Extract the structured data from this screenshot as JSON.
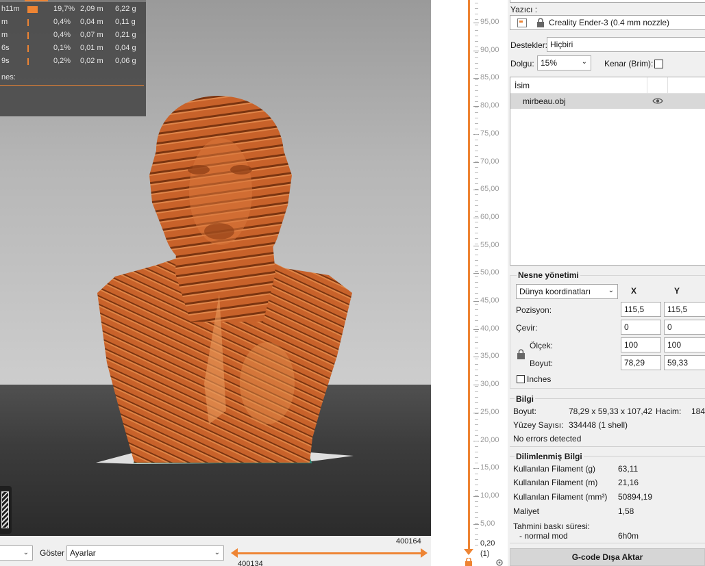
{
  "stats": {
    "rows": [
      {
        "label": "h11m",
        "pct": "19,7%",
        "meters": "2,09 m",
        "grams": "6,22 g",
        "fill": 0.197
      },
      {
        "label": "m",
        "pct": "0,4%",
        "meters": "0,04 m",
        "grams": "0,11 g",
        "fill": 0.004
      },
      {
        "label": "m",
        "pct": "0,4%",
        "meters": "0,07 m",
        "grams": "0,21 g",
        "fill": 0.004
      },
      {
        "label": "6s",
        "pct": "0,1%",
        "meters": "0,01 m",
        "grams": "0,04 g",
        "fill": 0.001
      },
      {
        "label": "9s",
        "pct": "0,2%",
        "meters": "0,02 m",
        "grams": "0,06 g",
        "fill": 0.002
      }
    ],
    "footer_label": "nes:"
  },
  "colors": {
    "accent": "#ee8433",
    "model": "#c8622a"
  },
  "bottom_bar": {
    "view_combo_value": "",
    "show_label": "Göster",
    "show_value": "Ayarlar",
    "move_top": "400164",
    "move_bottom": "400134"
  },
  "layer_slider": {
    "labels": [
      "95,00",
      "90,00",
      "85,00",
      "80,00",
      "75,00",
      "70,00",
      "65,00",
      "60,00",
      "55,00",
      "50,00",
      "45,00",
      "40,00",
      "35,00",
      "30,00",
      "25,00",
      "20,00",
      "15,00",
      "10,00",
      "5,00"
    ],
    "bottom_value": "0,20",
    "bottom_index": "(1)"
  },
  "panel": {
    "printer_label": "Yazıcı :",
    "printer_value": "Creality Ender-3 (0.4 mm nozzle)",
    "supports_label": "Destekler:",
    "supports_value": "Hiçbiri",
    "infill_label": "Dolgu:",
    "infill_value": "15%",
    "brim_label": "Kenar (Brim):",
    "brim_checked": false,
    "objects_header": "İsim",
    "object_name": "mirbeau.obj",
    "manip_title": "Nesne yönetimi",
    "coord_combo": "Dünya koordinatları",
    "col_x": "X",
    "col_y": "Y",
    "position_label": "Pozisyon:",
    "position_x": "115,5",
    "position_y": "115,5",
    "rotate_label": "Çevir:",
    "rotate_x": "0",
    "rotate_y": "0",
    "scale_label": "Ölçek:",
    "scale_x": "100",
    "scale_y": "100",
    "size_label": "Boyut:",
    "size_x": "78,29",
    "size_y": "59,33",
    "inches_label": "Inches",
    "info_title": "Bilgi",
    "info_size_label": "Boyut:",
    "info_size_value": "78,29 x 59,33 x 107,42",
    "info_volume_label": "Hacim:",
    "info_volume_value": "184",
    "info_facets_label": "Yüzey Sayısı:",
    "info_facets_value": "334448 (1 shell)",
    "info_errors": "No errors detected",
    "sliced_title": "Dilimlenmiş Bilgi",
    "sliced_rows": [
      {
        "label": "Kullanılan Filament (g)",
        "value": "63,11"
      },
      {
        "label": "Kullanılan Filament (m)",
        "value": "21,16"
      },
      {
        "label": "Kullanılan Filament (mm³)",
        "value": "50894,19"
      },
      {
        "label": "Maliyet",
        "value": "1,58"
      }
    ],
    "est_time_label": "Tahmini baskı süresi:",
    "normal_mode_label": "- normal mod",
    "normal_mode_value": "6h0m",
    "export_button": "G-code Dışa Aktar"
  }
}
